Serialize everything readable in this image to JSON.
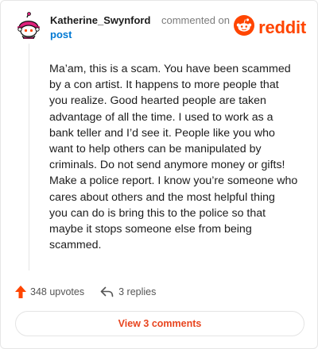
{
  "header": {
    "username": "Katherine_Swynford",
    "action_text": "commented on",
    "post_link": "post",
    "brand": "reddit"
  },
  "comment": {
    "body": "Ma’am, this is a scam. You have been scammed\nby a con artist. It happens to more people that\nyou realize. Good hearted people are taken\nadvantage of all the time. I used to work as a\nbank teller and I’d see it. People like you who\nwant to help others can be manipulated by\ncriminals. Do not send anymore money or gifts!\nMake a police report. I know you’re someone who\ncares about others and the most helpful thing\nyou can do is bring this to the police so that\nmaybe it stops someone else from being\nscammed."
  },
  "actions": {
    "upvotes_label": "348 upvotes",
    "replies_label": "3 replies"
  },
  "footer": {
    "view_comments_label": "View 3 comments"
  },
  "colors": {
    "brand_orange": "#ff4500",
    "link_blue": "#0079d3",
    "button_text": "#e8451f",
    "avatar_pink": "#e0217c"
  },
  "icons": {
    "avatar": "snoo-avatar-icon",
    "logo": "reddit-snoo-icon",
    "upvote": "upvote-arrow-icon",
    "reply": "reply-arrow-icon"
  }
}
